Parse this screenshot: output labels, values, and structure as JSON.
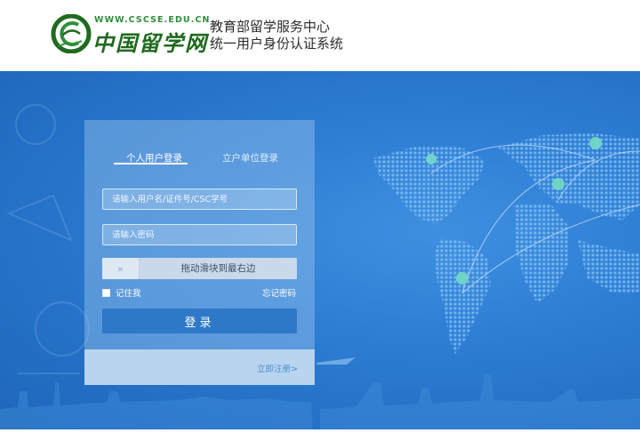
{
  "header": {
    "logo_url_text": "WWW.CSCSE.EDU.CN",
    "logo_name": "中国留学网",
    "logo_icon": "cscse-logo-icon",
    "system_title_line1": "教育部留学服务中心",
    "system_title_line2": "统一用户身份认证系统"
  },
  "login": {
    "tabs": [
      {
        "label": "个人用户登录",
        "active": true
      },
      {
        "label": "立户单位登录",
        "active": false
      }
    ],
    "username_placeholder": "请输入用户名/证件号/CSC学号",
    "password_placeholder": "请输入密码",
    "slider": {
      "handle_icon": "double-chevron-right-icon",
      "handle_glyph": "»",
      "text": "拖动滑块到最右边"
    },
    "remember_label": "记住我",
    "forgot_label": "忘记密码",
    "submit_label": "登录",
    "register_label": "立即注册>"
  },
  "colors": {
    "banner_blue": "#2f7fd6",
    "login_button": "#2d78c7",
    "logo_green": "#1f6a1f",
    "register_link": "#4a8cd1"
  }
}
